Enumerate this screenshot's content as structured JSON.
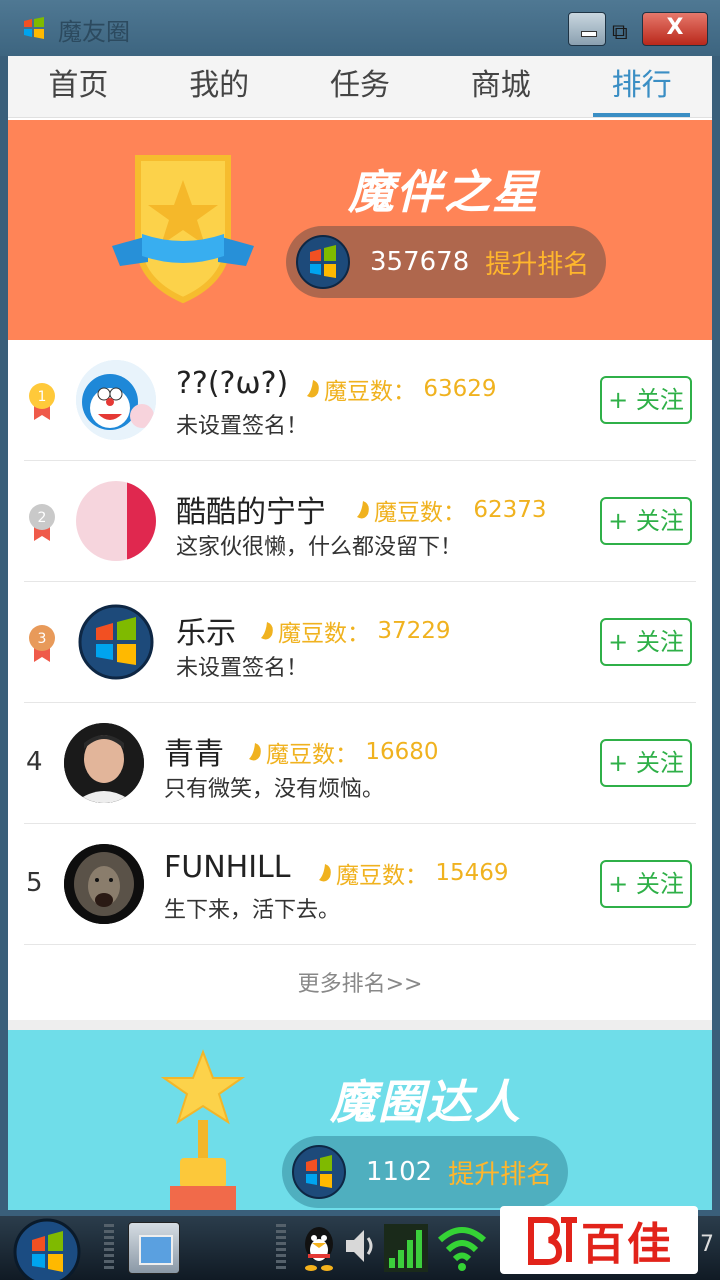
{
  "window": {
    "title": "魔友圈",
    "close_label": "X"
  },
  "tabs": [
    {
      "label": "首页",
      "active": false
    },
    {
      "label": "我的",
      "active": false
    },
    {
      "label": "任务",
      "active": false
    },
    {
      "label": "商城",
      "active": false
    },
    {
      "label": "排行",
      "active": true
    }
  ],
  "star_section": {
    "title": "魔伴之星",
    "my_score": "357678",
    "improve_label": "提升排名"
  },
  "ranking": {
    "bean_label": "魔豆数：",
    "follow_label": "+ 关注",
    "items": [
      {
        "rank": "1",
        "medal": "gold",
        "name": "??(?ω?)",
        "beans": "63629",
        "signature": "未设置签名！"
      },
      {
        "rank": "2",
        "medal": "silver",
        "name": "酷酷的宁宁",
        "beans": "62373",
        "signature": "这家伙很懒，什么都没留下！"
      },
      {
        "rank": "3",
        "medal": "bronze",
        "name": "乐示",
        "beans": "37229",
        "signature": "未设置签名！"
      },
      {
        "rank": "4",
        "medal": "",
        "name": "青青",
        "beans": "16680",
        "signature": "只有微笑，没有烦恼。"
      },
      {
        "rank": "5",
        "medal": "",
        "name": "FUNHILL",
        "beans": "15469",
        "signature": "生下来，活下去。"
      }
    ],
    "more_label": "更多排名>>"
  },
  "master_section": {
    "title": "魔圈达人",
    "my_score": "1102",
    "improve_label": "提升排名"
  },
  "watermark": {
    "text": "百佳"
  },
  "taskbar": {
    "clock_fragment": "7"
  },
  "colors": {
    "accent": "#3a8ec4",
    "star_bg": "#ff8457",
    "master_bg": "#6fdde9",
    "follow": "#2fb048",
    "beans": "#f0b21f"
  }
}
